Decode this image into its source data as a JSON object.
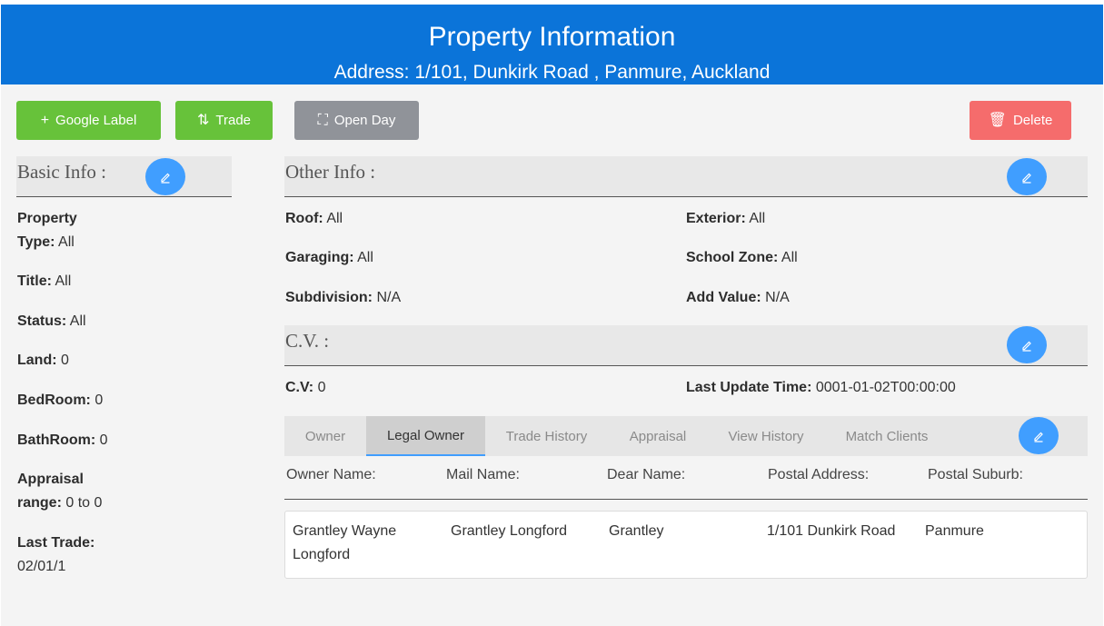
{
  "header": {
    "title": "Property Information",
    "address": "Address: 1/101, Dunkirk Road , Panmure, Auckland"
  },
  "toolbar": {
    "google_label": "Google Label",
    "trade": "Trade",
    "open_day": "Open Day",
    "delete": "Delete"
  },
  "basic_info": {
    "title": "Basic Info :",
    "property_type_label_1": "Property",
    "property_type_label_2": "Type:",
    "property_type_value": "All",
    "title_label": "Title:",
    "title_value": "All",
    "status_label": "Status:",
    "status_value": "All",
    "land_label": "Land:",
    "land_value": "0",
    "bedroom_label": "BedRoom:",
    "bedroom_value": "0",
    "bathroom_label": "BathRoom:",
    "bathroom_value": "0",
    "appraisal_label_1": "Appraisal",
    "appraisal_label_2": "range:",
    "appraisal_value": "0 to 0",
    "last_trade_label": "Last Trade:",
    "last_trade_value": "02/01/1"
  },
  "other_info": {
    "title": "Other Info :",
    "roof_label": "Roof:",
    "roof_value": "All",
    "exterior_label": "Exterior:",
    "exterior_value": "All",
    "garaging_label": "Garaging:",
    "garaging_value": "All",
    "school_zone_label": "School Zone:",
    "school_zone_value": "All",
    "subdivision_label": "Subdivision:",
    "subdivision_value": "N/A",
    "add_value_label": "Add Value:",
    "add_value_value": "N/A"
  },
  "cv": {
    "title": "C.V. :",
    "cv_label": "C.V:",
    "cv_value": "0",
    "last_update_label": "Last Update Time:",
    "last_update_value": "0001-01-02T00:00:00"
  },
  "tabs": {
    "owner": "Owner",
    "legal_owner": "Legal Owner",
    "trade_history": "Trade History",
    "appraisal": "Appraisal",
    "view_history": "View History",
    "match_clients": "Match Clients"
  },
  "owner_table": {
    "columns": [
      "Owner Name:",
      "Mail Name:",
      "Dear Name:",
      "Postal Address:",
      "Postal Suburb:"
    ],
    "row": {
      "owner_name_1": "Grantley Wayne",
      "owner_name_2": "Longford",
      "mail_name": "Grantley Longford",
      "dear_name": "Grantley",
      "postal_address": "1/101 Dunkirk Road",
      "postal_suburb": "Panmure"
    }
  },
  "icons": {
    "plus": "plus-icon",
    "trade": "sort-arrows-icon",
    "open_day": "fullscreen-icon",
    "delete": "trash-icon",
    "edit": "edit-pencil-icon"
  },
  "colors": {
    "header": "#0b74d9",
    "green": "#67c23a",
    "gray": "#909399",
    "red": "#f56c6c",
    "edit_blue": "#409eff"
  }
}
